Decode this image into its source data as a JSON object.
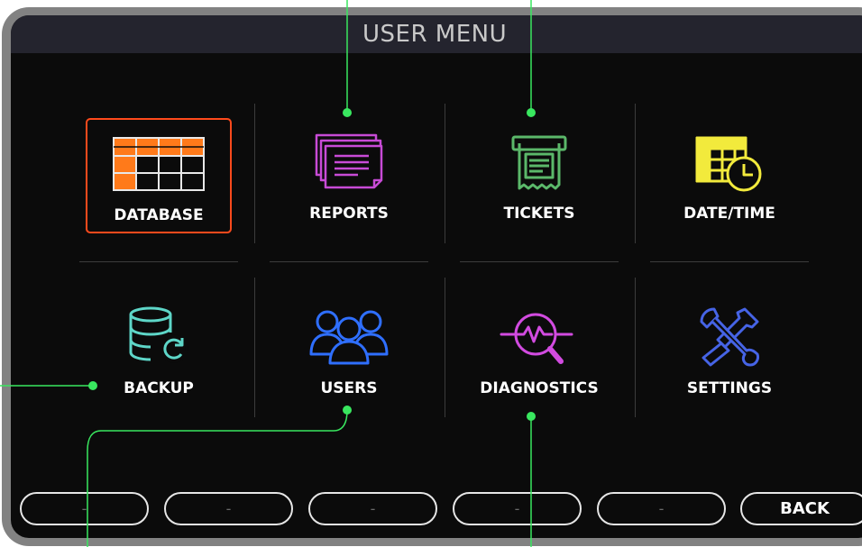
{
  "header": {
    "title": "USER MENU"
  },
  "menu": {
    "items": [
      {
        "label": "DATABASE",
        "icon": "database-grid-icon",
        "color": "#ff7a1a",
        "selected": true
      },
      {
        "label": "REPORTS",
        "icon": "reports-icon",
        "color": "#c84bd6"
      },
      {
        "label": "TICKETS",
        "icon": "ticket-printer-icon",
        "color": "#5bb86a"
      },
      {
        "label": "DATE/TIME",
        "icon": "calendar-clock-icon",
        "color": "#f2ea3c"
      },
      {
        "label": "BACKUP",
        "icon": "database-sync-icon",
        "color": "#5ed6c8"
      },
      {
        "label": "USERS",
        "icon": "users-icon",
        "color": "#2f6fff"
      },
      {
        "label": "DIAGNOSTICS",
        "icon": "diagnostics-icon",
        "color": "#d24be0"
      },
      {
        "label": "SETTINGS",
        "icon": "wrench-screwdriver-icon",
        "color": "#4664e6"
      }
    ]
  },
  "softkeys": {
    "keys": [
      {
        "label": "-"
      },
      {
        "label": "-"
      },
      {
        "label": "-"
      },
      {
        "label": "-"
      },
      {
        "label": "-"
      },
      {
        "label": "BACK"
      }
    ]
  },
  "colors": {
    "selection": "#ff4a1c",
    "callout": "#39e75f"
  }
}
